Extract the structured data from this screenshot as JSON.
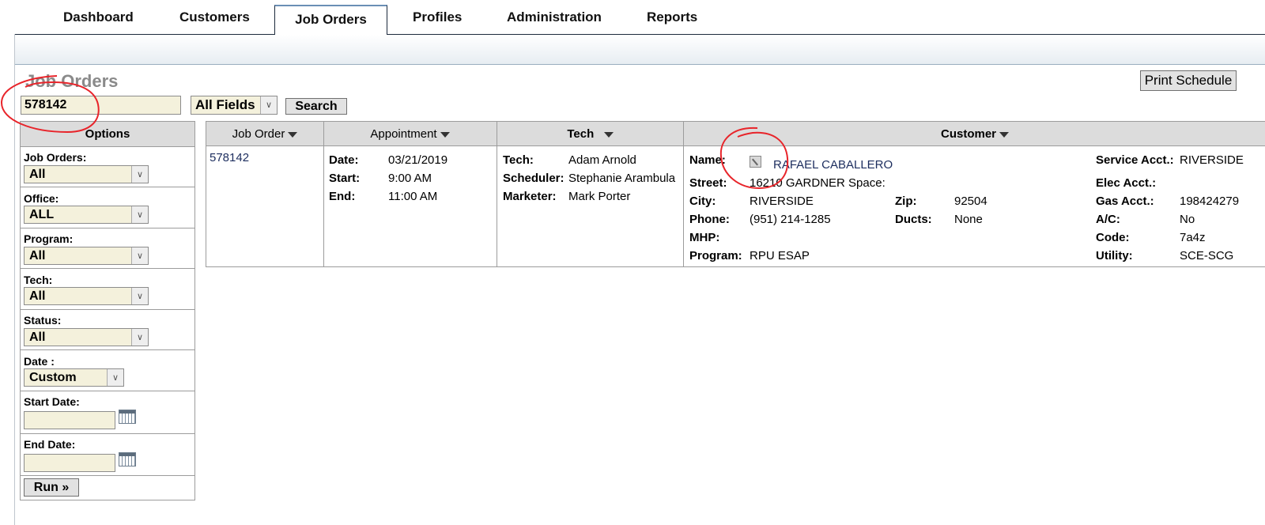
{
  "nav": {
    "tabs": [
      {
        "label": "Dashboard"
      },
      {
        "label": "Customers"
      },
      {
        "label": "Job Orders",
        "active": true
      },
      {
        "label": "Profiles"
      },
      {
        "label": "Administration"
      },
      {
        "label": "Reports"
      }
    ]
  },
  "page": {
    "title": "Job Orders",
    "print_label": "Print Schedule"
  },
  "search": {
    "value": "578142",
    "field": "All Fields",
    "button": "Search"
  },
  "options": {
    "title": "Options",
    "job_orders": {
      "label": "Job Orders:",
      "value": "All"
    },
    "office": {
      "label": "Office:",
      "value": "ALL"
    },
    "program": {
      "label": "Program:",
      "value": "All"
    },
    "tech": {
      "label": "Tech:",
      "value": "All"
    },
    "status": {
      "label": "Status:",
      "value": "All"
    },
    "date": {
      "label": "Date :",
      "value": "Custom"
    },
    "start_date": {
      "label": "Start Date:",
      "value": ""
    },
    "end_date": {
      "label": "End Date:",
      "value": ""
    },
    "run": "Run »"
  },
  "table": {
    "headers": {
      "job_order": "Job Order",
      "appointment": "Appointment",
      "tech": "Tech",
      "customer": "Customer"
    },
    "row": {
      "job_order": "578142",
      "appointment": {
        "date_label": "Date:",
        "date": "03/21/2019",
        "start_label": "Start:",
        "start": "9:00 AM",
        "end_label": "End:",
        "end": "11:00 AM"
      },
      "tech": {
        "tech_label": "Tech:",
        "tech": "Adam Arnold",
        "scheduler_label": "Scheduler:",
        "scheduler": "Stephanie Arambula",
        "marketer_label": "Marketer:",
        "marketer": "Mark Porter"
      },
      "customer": {
        "name_label": "Name:",
        "name": "RAFAEL CABALLERO",
        "street_label": "Street:",
        "street": "16210 GARDNER Space:",
        "city_label": "City:",
        "city": "RIVERSIDE",
        "zip_label": "Zip:",
        "zip": "92504",
        "phone_label": "Phone:",
        "phone": "(951) 214-1285",
        "ducts_label": "Ducts:",
        "ducts": "None",
        "mhp_label": "MHP:",
        "program_label": "Program:",
        "program": "RPU ESAP",
        "service_acct_label": "Service Acct.:",
        "service_acct": "RIVERSIDE",
        "elec_acct_label": "Elec Acct.:",
        "gas_acct_label": "Gas Acct.:",
        "gas_acct": "198424279",
        "ac_label": "A/C:",
        "ac": "No",
        "code_label": "Code:",
        "code": "7a4z",
        "utility_label": "Utility:",
        "utility": "SCE-SCG"
      }
    }
  },
  "colors": {
    "annotation": "#e8242a",
    "link": "#1c2d5e",
    "input_bg": "#f4f1dc",
    "header_bg": "#dcdcdc"
  }
}
